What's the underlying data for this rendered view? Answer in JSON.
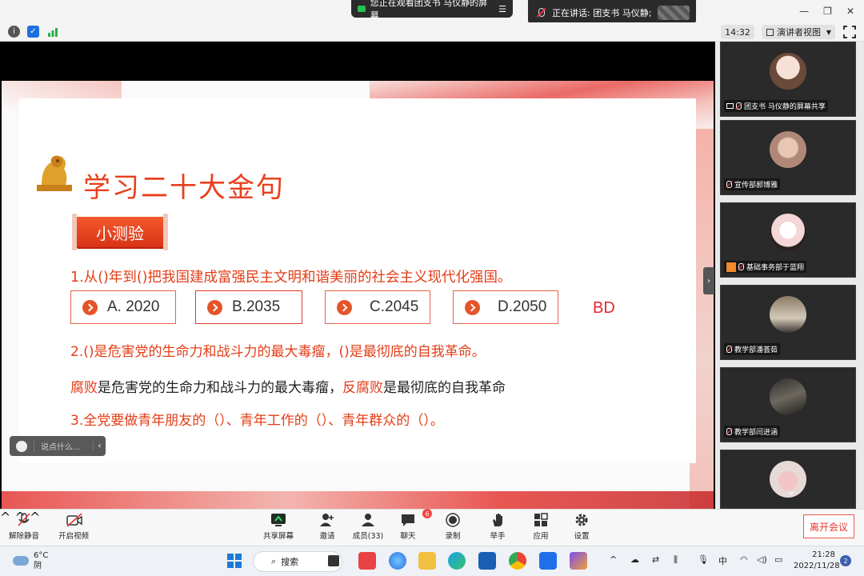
{
  "top": {
    "viewing_text": "您正在观看团支书 马仪静的屏幕",
    "speaking_text": "正在讲话: 团支书 马仪静;",
    "win_min": "—",
    "win_restore": "❐",
    "win_close": "✕"
  },
  "toolbar2": {
    "time": "14:32",
    "view_mode": "演讲者视图"
  },
  "slide": {
    "title": "学习二十大金句",
    "tag": "小测验",
    "q1": "1.从()年到()把我国建成富强民主文明和谐美丽的社会主义现代化强国。",
    "options": [
      "A.  2020",
      "B.2035",
      "C.2045",
      "D.2050"
    ],
    "answer": "BD",
    "q2": "2.()是危害党的生命力和战斗力的最大毒瘤，()是最彻底的自我革命。",
    "a2_part1": "腐败",
    "a2_part2": "是危害党的生命力和战斗力的最大毒瘤，",
    "a2_part3": "反腐败",
    "a2_part4": "是最彻底的自我革命",
    "q3": "3.全党要做青年朋友的（）、青年工作的（）、青年群众的（）。",
    "chat_placeholder": "说点什么..."
  },
  "participants": [
    {
      "name": "团支书 马仪静的屏幕共享",
      "avatar_color": "#f0d8d0"
    },
    {
      "name": "宣传部郝博雅",
      "avatar_color": "#d9b8a2"
    },
    {
      "name": "基础事务部于蓝翔",
      "avatar_color": "#f7e2e2"
    },
    {
      "name": "教学部潘荟茹",
      "avatar_color": "#6b6257"
    },
    {
      "name": "教学部闫进涵",
      "avatar_color": "#3b3a38"
    },
    {
      "name": "",
      "avatar_color": "#e9c9c6"
    }
  ],
  "meetbar": {
    "unmute": "解除静音",
    "video": "开启视频",
    "share": "共享屏幕",
    "invite": "邀请",
    "members": "成员(33)",
    "chat": "聊天",
    "chat_badge": "6",
    "record": "录制",
    "hand": "举手",
    "apps": "应用",
    "settings": "设置",
    "leave": "离开会议"
  },
  "taskbar": {
    "temp": "6°C",
    "weather": "阴",
    "search": "搜索",
    "ime": "中",
    "time": "21:28",
    "date": "2022/11/28",
    "notif_count": "2"
  }
}
